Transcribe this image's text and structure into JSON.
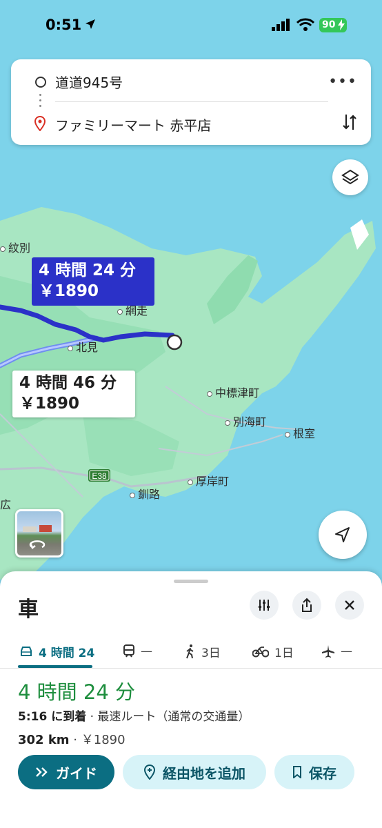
{
  "status_bar": {
    "time": "0:51",
    "battery": "90"
  },
  "search": {
    "origin": "道道945号",
    "destination": "ファミリーマート 赤平店",
    "more_label": "•••"
  },
  "map": {
    "route_primary": {
      "duration": "4 時間 24 分",
      "price": "￥1890",
      "color": "#2b31c8"
    },
    "route_alt": {
      "duration": "4 時間 46 分",
      "price": "￥1890"
    },
    "places": {
      "monbetsu": "紋別",
      "abashiri": "網走",
      "kitami": "北見",
      "nakashibetsu": "中標津町",
      "betsukai": "別海町",
      "nemuro": "根室",
      "akkeshi": "厚岸町",
      "kushiro": "釧路",
      "hiro": "広",
      "e38": "E38"
    },
    "colors": {
      "sea": "#7dd3ea",
      "land": "#a8e6c2",
      "forest": "#8fdcaf"
    }
  },
  "sheet": {
    "title": "車",
    "tabs": [
      {
        "label": "4 時間 24",
        "icon": "car-icon"
      },
      {
        "label": "—",
        "icon": "train-icon"
      },
      {
        "label": "3日",
        "icon": "walk-icon"
      },
      {
        "label": "1日",
        "icon": "bike-icon"
      },
      {
        "label": "—",
        "icon": "plane-icon"
      }
    ],
    "duration": "4 時間 24 分",
    "arrival_time": "5:16 に到着",
    "arrival_detail": " · 最速ルート（通常の交通量）",
    "distance": "302 km",
    "toll": " · ￥1890",
    "buttons": {
      "guide": "ガイド",
      "add_waypoint": "経由地を追加",
      "save": "保存"
    },
    "accent": "#0b6e82",
    "duration_color": "#1e8e3e"
  }
}
